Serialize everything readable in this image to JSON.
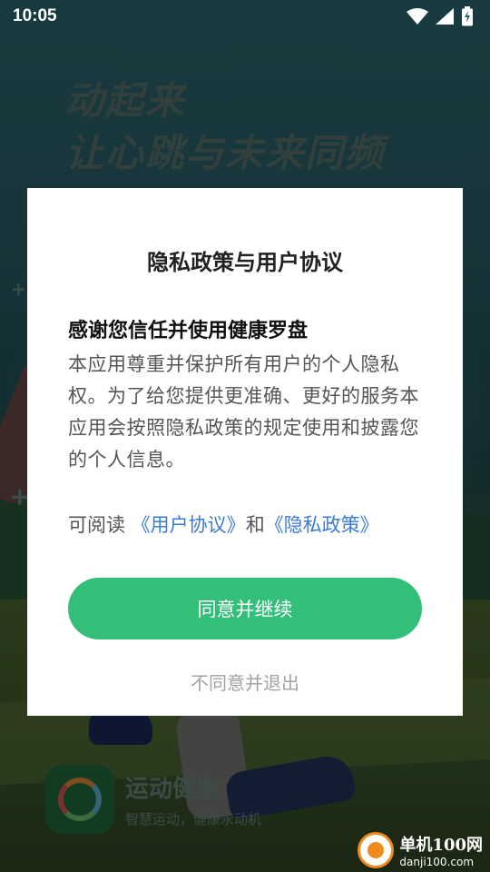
{
  "status_bar": {
    "time": "10:05",
    "icons": [
      "wifi-icon",
      "signal-icon",
      "battery-charging-icon"
    ]
  },
  "splash": {
    "slogan_line1": "动起来",
    "slogan_line2": "让心跳与未来同频",
    "app_name": "运动健康",
    "app_tagline": "智慧运动，健康永动机"
  },
  "dialog": {
    "title": "隐私政策与用户协议",
    "heading": "感谢您信任并使用健康罗盘",
    "body": "本应用尊重并保护所有用户的个人隐私权。为了给您提供更准确、更好的服务本应用会按照隐私政策的规定使用和披露您的个人信息。",
    "read_prefix": "可阅读 ",
    "user_agreement_link": "《用户协议》",
    "and_text": "和",
    "privacy_policy_link": "《隐私政策》",
    "agree_label": "同意并继续",
    "disagree_label": "不同意并退出"
  },
  "watermark": {
    "cn": "单机100网",
    "en": "danji100.com"
  },
  "colors": {
    "accent_green": "#33be7a",
    "link_blue": "#3a7bd5"
  }
}
